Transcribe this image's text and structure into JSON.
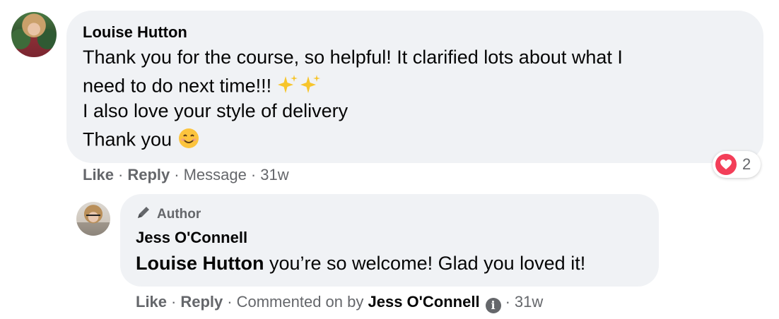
{
  "comment": {
    "author": "Louise Hutton",
    "lines": [
      "Thank you for the course, so helpful! It clarified lots about what I",
      "need to do next time!!! ",
      "I also love your style of delivery",
      "Thank you "
    ],
    "actions": {
      "like": "Like",
      "reply": "Reply",
      "message": "Message",
      "time": "31w",
      "sep": "·"
    },
    "reaction": {
      "icon": "heart-reaction-icon",
      "count": "2",
      "color": "#f33e58"
    }
  },
  "reply": {
    "badge": "Author",
    "badge_icon": "author-pen-icon",
    "author": "Jess O'Connell",
    "mention": "Louise Hutton",
    "text": " you’re so welcome! Glad you loved it!",
    "actions": {
      "like": "Like",
      "reply": "Reply",
      "commented_on_by": "Commented on by",
      "commenter": "Jess O'Connell",
      "info_icon": "info-icon",
      "time": "31w",
      "sep": "·"
    }
  },
  "colors": {
    "bubble": "#f0f2f5",
    "secondary_text": "#65676b",
    "primary_text": "#050505"
  }
}
